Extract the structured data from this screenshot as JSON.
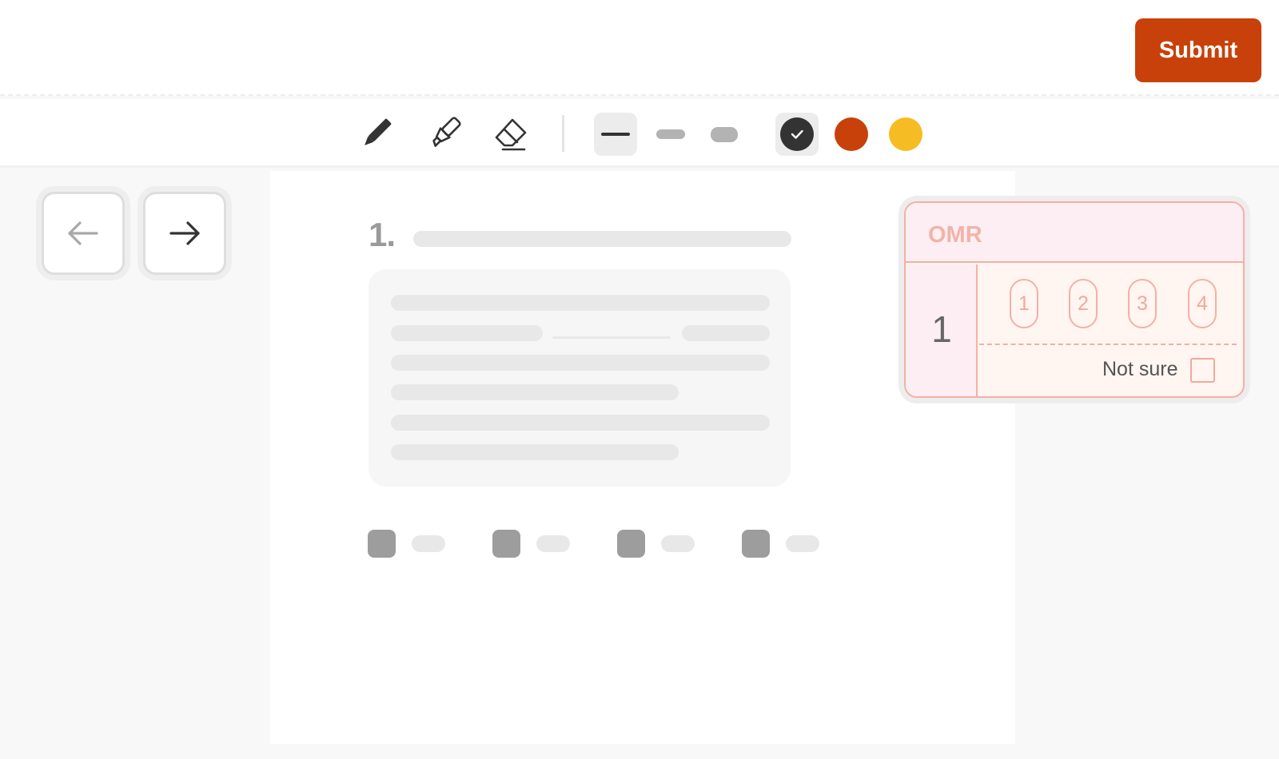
{
  "header": {
    "submit_label": "Submit"
  },
  "toolbar": {
    "tools": [
      "pencil-icon",
      "highlighter-icon",
      "eraser-icon"
    ],
    "thickness_options": [
      "thin",
      "medium",
      "thick"
    ],
    "selected_thickness": "thin",
    "colors": [
      "#333333",
      "#c8410a",
      "#f6bc23"
    ],
    "selected_color": "#333333"
  },
  "navigation": {
    "prev": "arrow-left-icon",
    "next": "arrow-right-icon"
  },
  "question": {
    "number": "1."
  },
  "omr": {
    "title": "OMR",
    "question_number": "1",
    "choices": [
      "1",
      "2",
      "3",
      "4"
    ],
    "not_sure_label": "Not sure",
    "not_sure_checked": false
  }
}
